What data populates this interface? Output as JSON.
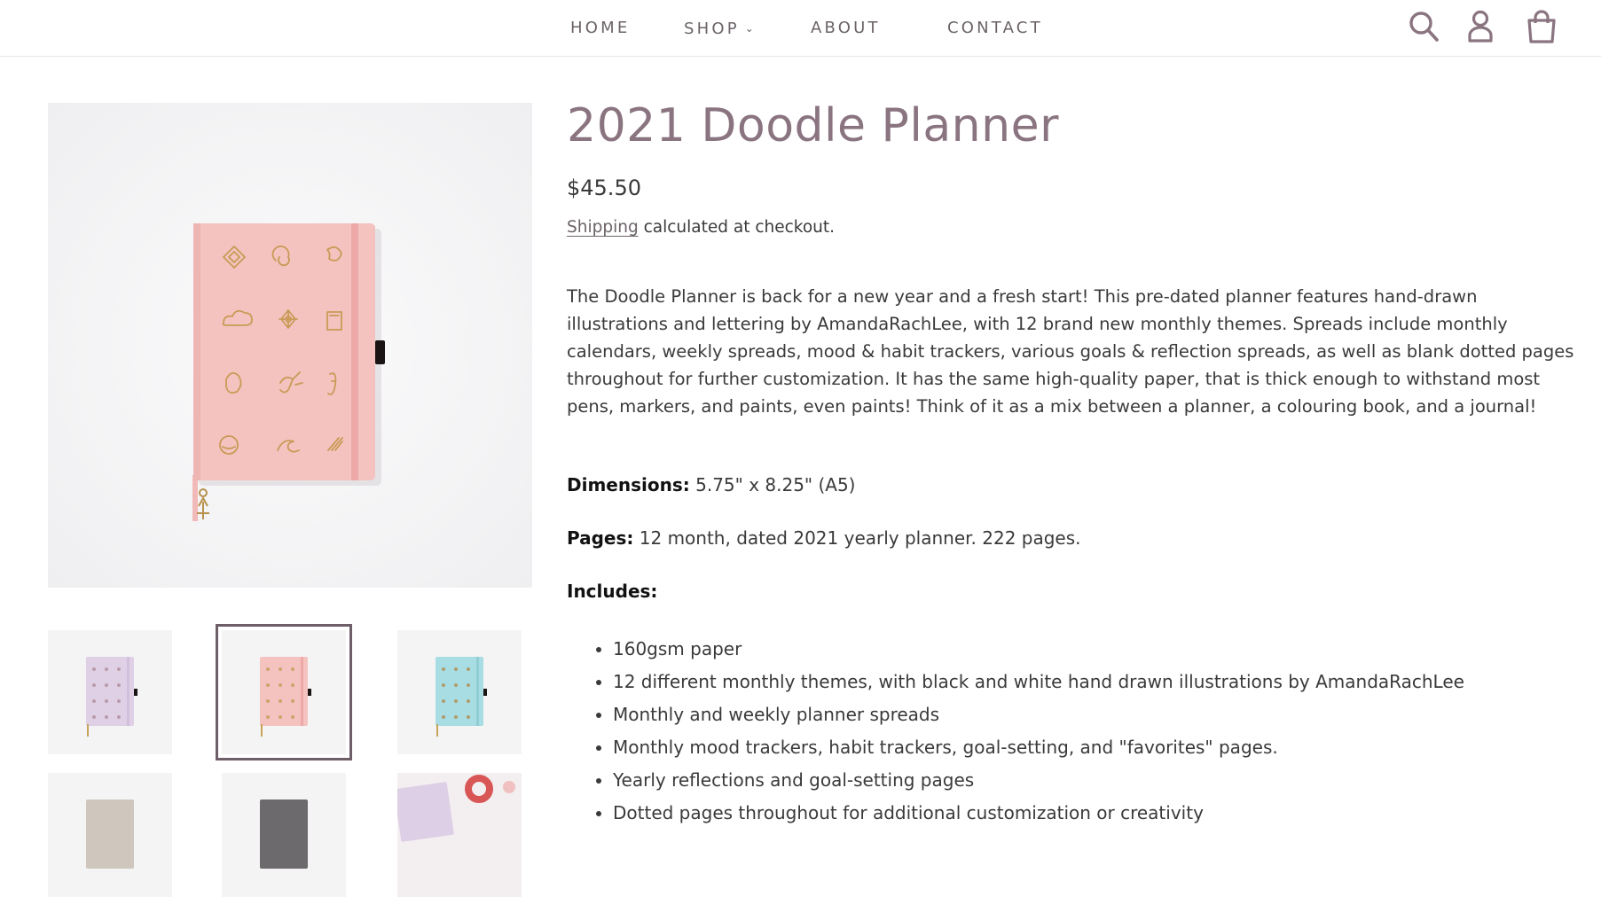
{
  "nav": {
    "home": "HOME",
    "shop": "SHOP",
    "about": "ABOUT",
    "contact": "CONTACT"
  },
  "header_icons": [
    "search-icon",
    "account-icon",
    "cart-icon"
  ],
  "colors": {
    "accent": "#8a7480",
    "nav_text": "#6b6368",
    "active_thumb_border": "#6e5e67",
    "pink_cover": "#f4c3c0",
    "lavender_cover": "#dfd0e6",
    "blue_cover": "#a8dde3"
  },
  "gallery": {
    "selected_index": 1,
    "thumbnails": [
      "lavender",
      "pink",
      "blue",
      "beige",
      "gray",
      "lavender-with-tape"
    ]
  },
  "product": {
    "title": "2021 Doodle Planner",
    "price": "$45.50",
    "shipping_link": "Shipping",
    "shipping_text": " calculated at checkout.",
    "description": "The Doodle Planner is back for a new year and a fresh start! This pre-dated planner features hand-drawn illustrations and lettering by AmandaRachLee, with 12 brand new monthly themes. Spreads include monthly calendars, weekly spreads, mood & habit trackers, various goals & reflection spreads, as well as blank dotted pages throughout for further customization. It has the same high-quality paper, that is thick enough to withstand most pens, markers, and paints, even paints! Think of it as a mix between a planner, a colouring book, and a journal!",
    "dimensions_label": "Dimensions:",
    "dimensions_value": " 5.75\" x 8.25\" (A5)",
    "pages_label": "Pages:",
    "pages_value": " 12 month, dated 2021 yearly planner. 222 pages.",
    "includes_label": "Includes:",
    "includes": [
      "160gsm paper",
      "12 different monthly themes, with black and white hand drawn illustrations by AmandaRachLee",
      "Monthly and weekly planner spreads",
      "Monthly mood trackers, habit trackers, goal-setting, and \"favorites\" pages.",
      "Yearly reflections and goal-setting pages",
      "Dotted pages throughout for additional customization or creativity"
    ]
  }
}
